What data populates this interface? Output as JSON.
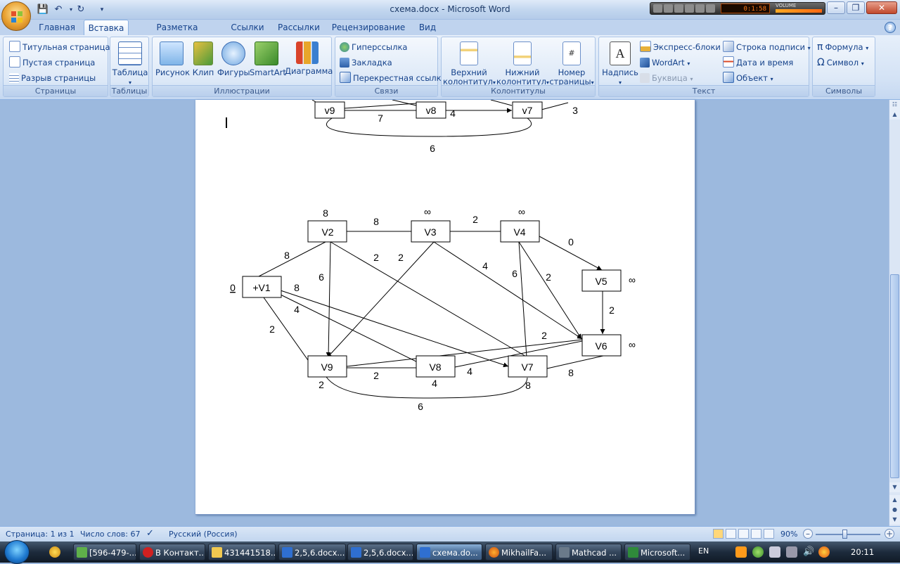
{
  "app": {
    "window_title": "схема.docx - Microsoft Word",
    "quick_access": [
      "save-icon",
      "undo-icon",
      "redo-icon",
      "customize-icon"
    ]
  },
  "media_player": {
    "time": "0:1:58",
    "volume_label": "VOLUME"
  },
  "tabs": [
    "Главная",
    "Вставка",
    "Разметка страницы",
    "Ссылки",
    "Рассылки",
    "Рецензирование",
    "Вид"
  ],
  "active_tab": "Вставка",
  "ribbon": {
    "pages": {
      "label": "Страницы",
      "items": [
        "Титульная страница",
        "Пустая страница",
        "Разрыв страницы"
      ]
    },
    "tables": {
      "label": "Таблицы",
      "table": "Таблица"
    },
    "illustrations": {
      "label": "Иллюстрации",
      "items": [
        "Рисунок",
        "Клип",
        "Фигуры",
        "SmartArt",
        "Диаграмма"
      ]
    },
    "links": {
      "label": "Связи",
      "items": [
        "Гиперссылка",
        "Закладка",
        "Перекрестная ссылка"
      ]
    },
    "headers": {
      "label": "Колонтитулы",
      "header_l1": "Верхний",
      "header_l2": "колонтитул",
      "footer_l1": "Нижний",
      "footer_l2": "колонтитул",
      "pagenum_l1": "Номер",
      "pagenum_l2": "страницы"
    },
    "text": {
      "label": "Текст",
      "textbox": "Надпись",
      "items": [
        "Экспресс-блоки",
        "WordArt",
        "Буквица",
        "Строка подписи",
        "Дата и время",
        "Объект"
      ]
    },
    "symbols": {
      "label": "Символы",
      "items": [
        "Формула",
        "Символ"
      ]
    }
  },
  "diagram_top": {
    "nodes": [
      "v9",
      "v8",
      "v7"
    ],
    "weights": [
      "7",
      "4",
      "3",
      "6"
    ]
  },
  "diagram_main": {
    "nodes": [
      "V2",
      "V3",
      "V4",
      "+V1",
      "V5",
      "V6",
      "V9",
      "V8",
      "V7"
    ],
    "node_marks": [
      "8",
      "∞",
      "∞",
      "0",
      "∞",
      "∞"
    ],
    "edge_weights": [
      "8",
      "2",
      "0",
      "8",
      "2",
      "2",
      "4",
      "6",
      "6",
      "2",
      "2",
      "8",
      "4",
      "2",
      "2",
      "2",
      "4",
      "4",
      "8",
      "8",
      "2",
      "6"
    ]
  },
  "status": {
    "page": "Страница: 1 из 1",
    "words": "Число слов: 67",
    "language": "Русский (Россия)",
    "zoom": "90%"
  },
  "taskbar": {
    "tasks": [
      "[596-479-...",
      "В Контакт...",
      "431441518...",
      "2,5,6.docx...",
      "2,5,6.docx...",
      "схема.do...",
      "MikhailFa...",
      "Mathcad ...",
      "Microsoft..."
    ],
    "lang": "EN",
    "clock": "20:11"
  },
  "colors": {
    "ribbon_text": "#15428b",
    "page": "#ffffff",
    "workspace": "#9cb9de"
  }
}
